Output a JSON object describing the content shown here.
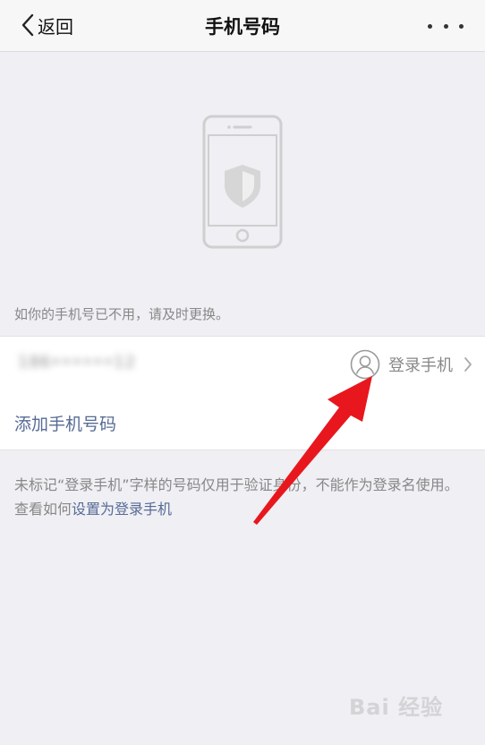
{
  "navbar": {
    "back_label": "返回",
    "title": "手机号码",
    "more_icon": "ellipsis-icon"
  },
  "hint": "如你的手机号已不用，请及时更换。",
  "phone_entry": {
    "number": "186••••••12",
    "tag_label": "登录手机",
    "tag_icon": "user-icon"
  },
  "add_phone_label": "添加手机号码",
  "note": {
    "text": "未标记“登录手机”字样的号码仅用于验证身份，不能作为登录名使用。查看如何",
    "link": "设置为登录手机"
  },
  "watermark": "Bai 经验",
  "colors": {
    "link": "#576b95",
    "background": "#efeff4",
    "annotation_arrow": "#e8171e"
  }
}
